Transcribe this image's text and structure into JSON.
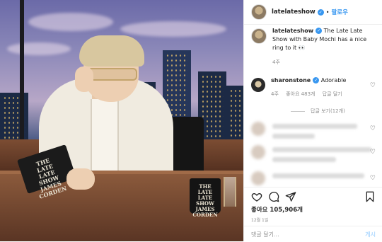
{
  "header": {
    "username": "latelateshow",
    "separator": "•",
    "follow_label": "팔로우"
  },
  "caption": {
    "username": "latelateshow",
    "text": "The Late Late Show with Baby Mochi has a nice ring to it 👀",
    "time": "4주"
  },
  "comments": [
    {
      "username": "sharonstone",
      "text": "Adorable",
      "time": "4주",
      "likes": "좋아요 483개",
      "reply_label": "답글 달기",
      "view_replies": "답글 보기(12개)"
    }
  ],
  "photo": {
    "book_text": "THE LATE LATE SHOW JAMES CORDEN",
    "mug_text": "THE LATE LATE SHOW JAMES CORDEN"
  },
  "actions": {
    "heart_icon": "heart-icon",
    "comment_icon": "comment-icon",
    "share_icon": "share-icon",
    "bookmark_icon": "bookmark-icon"
  },
  "likes": "좋아요 105,906개",
  "date": "12월 1일",
  "comment_box": {
    "placeholder": "댓글 달기...",
    "post_label": "게시"
  },
  "colors": {
    "accent": "#3897f0",
    "muted": "#8e8e8e"
  }
}
